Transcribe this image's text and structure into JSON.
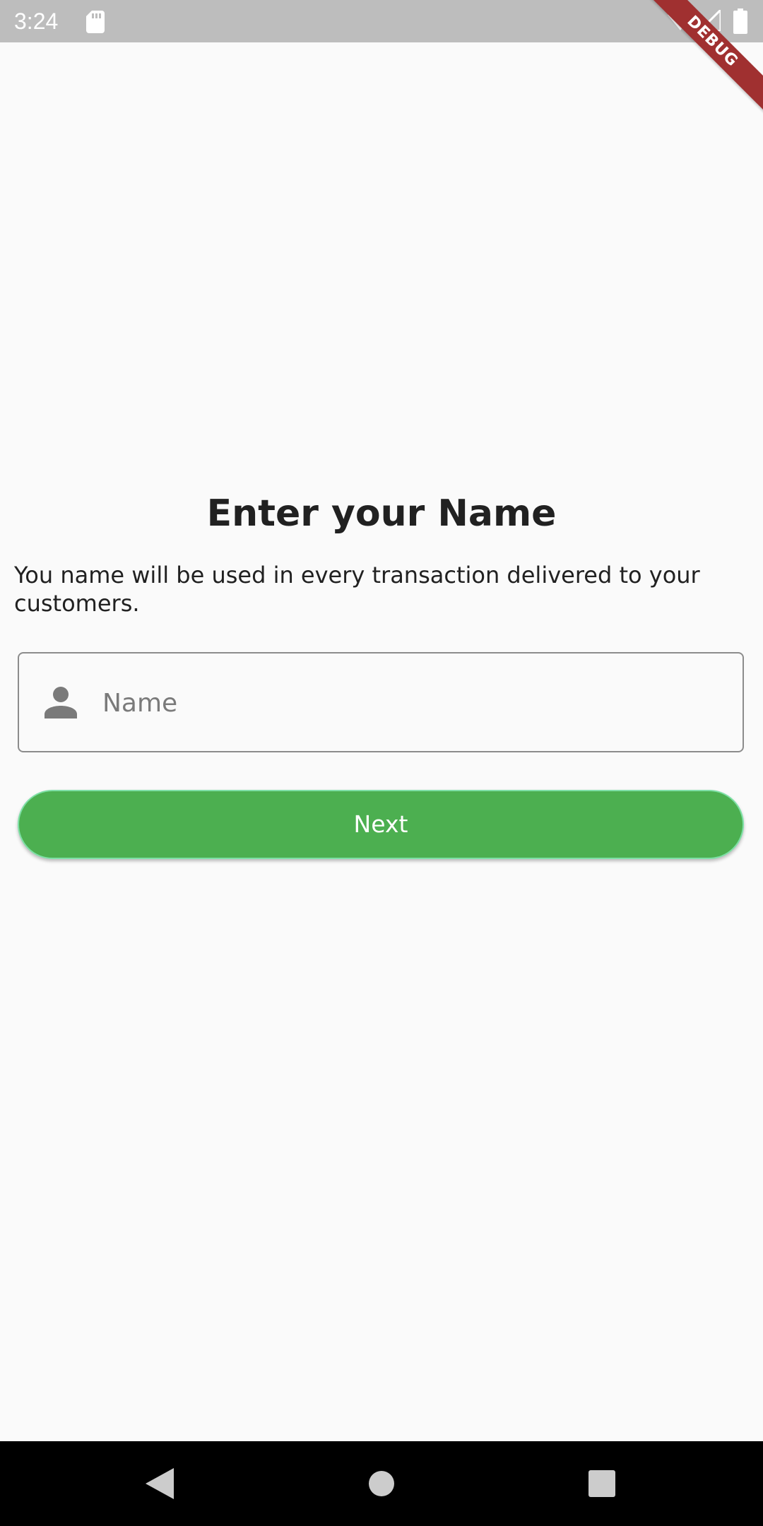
{
  "status_bar": {
    "time": "3:24",
    "icons": [
      "sd-card-icon",
      "wifi-icon",
      "signal-icon",
      "battery-icon"
    ]
  },
  "debug_banner": {
    "label": "DEBUG",
    "color": "#a03030"
  },
  "main": {
    "title": "Enter your Name",
    "description": "You name will be used in every transaction delivered to your customers.",
    "name_field": {
      "icon": "person-icon",
      "placeholder": "Name",
      "value": ""
    },
    "next_button": {
      "label": "Next",
      "color": "#4caf50"
    }
  },
  "nav_bar": {
    "buttons": [
      "back-icon",
      "home-icon",
      "recents-icon"
    ]
  }
}
